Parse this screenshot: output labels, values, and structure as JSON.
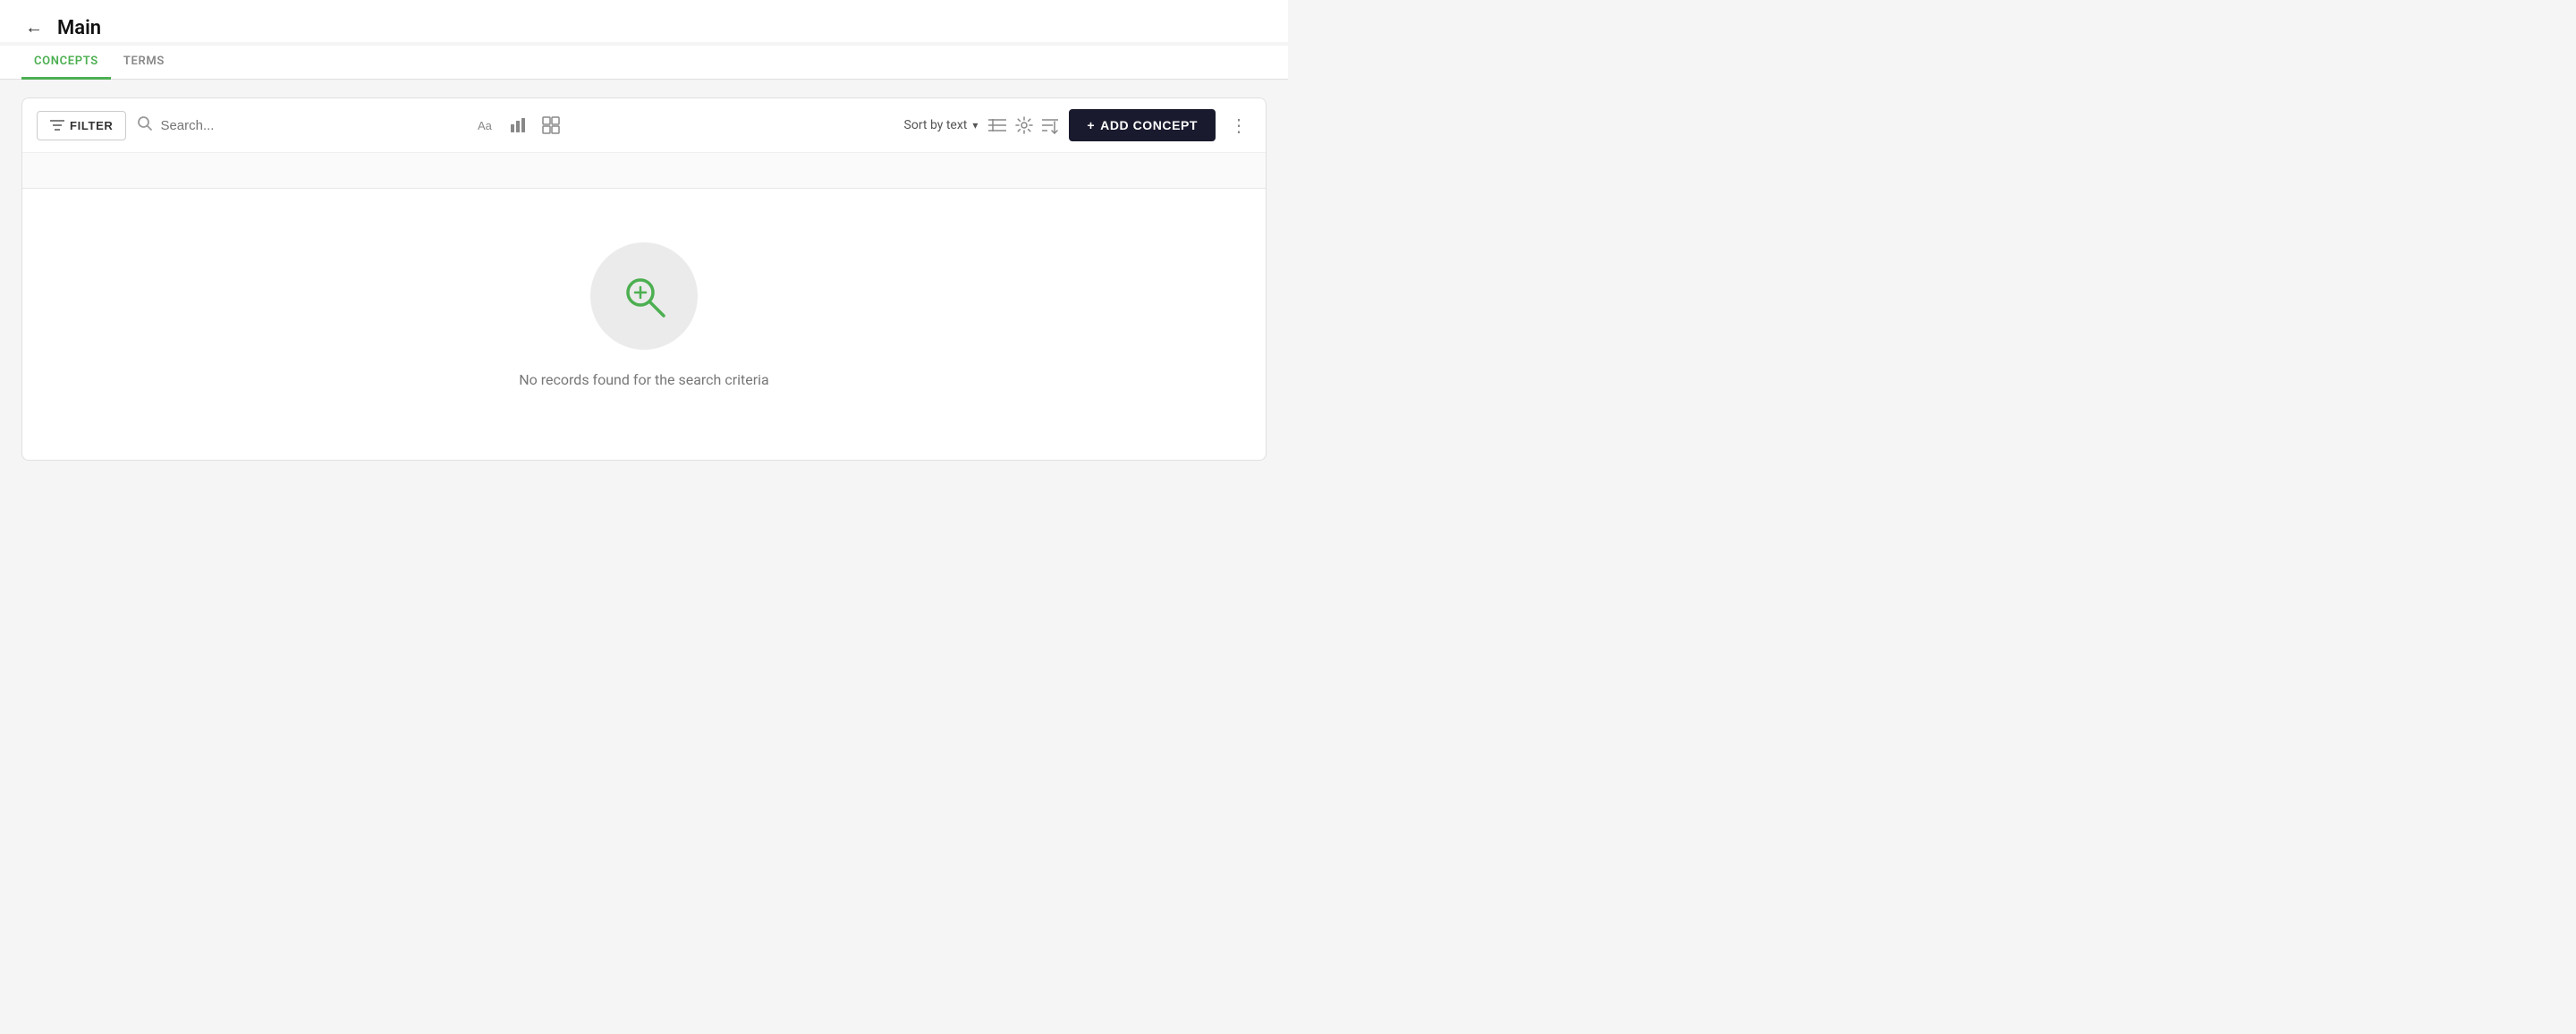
{
  "header": {
    "back_label": "←",
    "title": "Main"
  },
  "tabs": [
    {
      "id": "concepts",
      "label": "CONCEPTS",
      "active": true
    },
    {
      "id": "terms",
      "label": "TERMS",
      "active": false
    }
  ],
  "toolbar": {
    "filter_label": "FILTER",
    "search_placeholder": "Search...",
    "sort_label": "Sort by text",
    "add_concept_label": "ADD CONCEPT",
    "add_icon": "+"
  },
  "empty_state": {
    "message": "No records found for the search criteria"
  }
}
